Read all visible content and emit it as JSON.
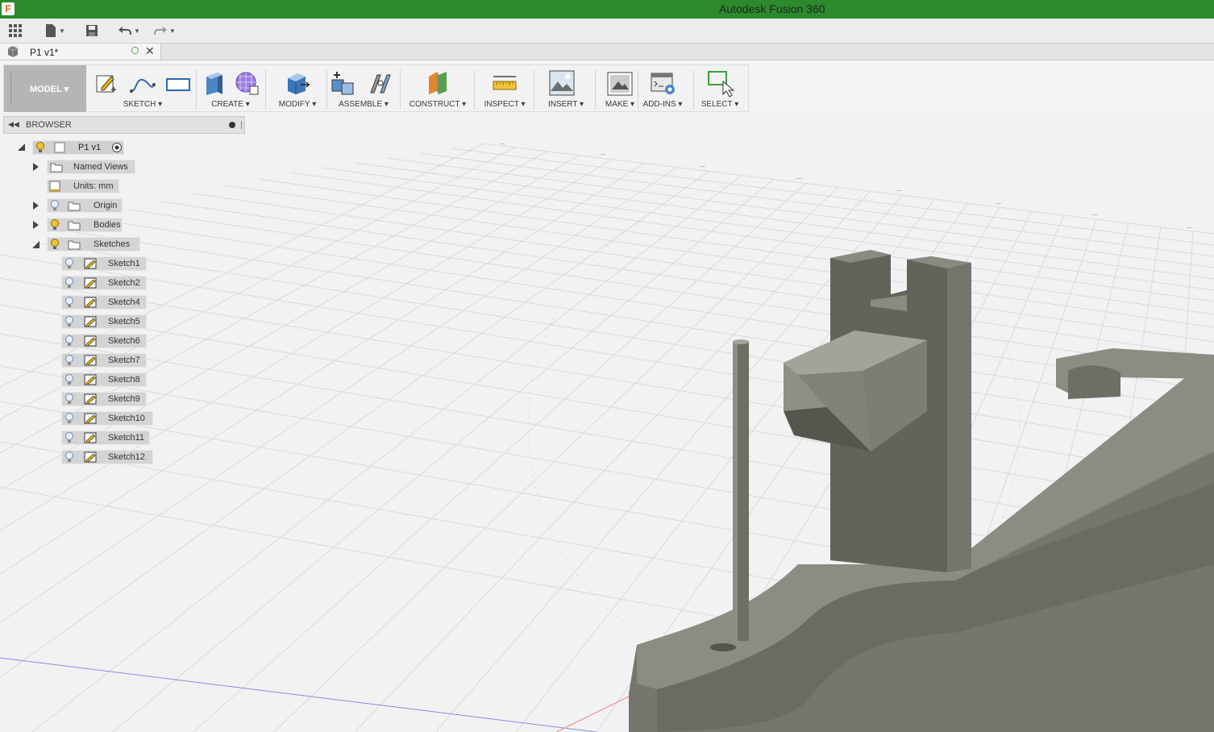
{
  "window": {
    "title": "Autodesk Fusion 360",
    "logo_letter": "F"
  },
  "document_tab": {
    "label": "P1 v1*"
  },
  "workspace": {
    "label": "MODEL ▾"
  },
  "toolbar_groups": [
    {
      "label": "SKETCH ▾"
    },
    {
      "label": "CREATE ▾"
    },
    {
      "label": "MODIFY ▾"
    },
    {
      "label": "ASSEMBLE ▾"
    },
    {
      "label": "CONSTRUCT ▾"
    },
    {
      "label": "INSPECT ▾"
    },
    {
      "label": "INSERT ▾"
    },
    {
      "label": "MAKE ▾"
    },
    {
      "label": "ADD-INS ▾"
    },
    {
      "label": "SELECT ▾"
    }
  ],
  "browser": {
    "title": "BROWSER",
    "root": "P1 v1",
    "named_views": "Named Views",
    "units": "Units: mm",
    "origin": "Origin",
    "bodies": "Bodies",
    "sketches_folder": "Sketches",
    "sketches": [
      "Sketch1",
      "Sketch2",
      "Sketch4",
      "Sketch5",
      "Sketch6",
      "Sketch7",
      "Sketch8",
      "Sketch9",
      "Sketch10",
      "Sketch11",
      "Sketch12"
    ]
  },
  "colors": {
    "titlebar": "#2b8a2b",
    "model_body": "#7a7a70",
    "sketch_icon": "#e8b400",
    "bulb_on": "#f2c230"
  }
}
